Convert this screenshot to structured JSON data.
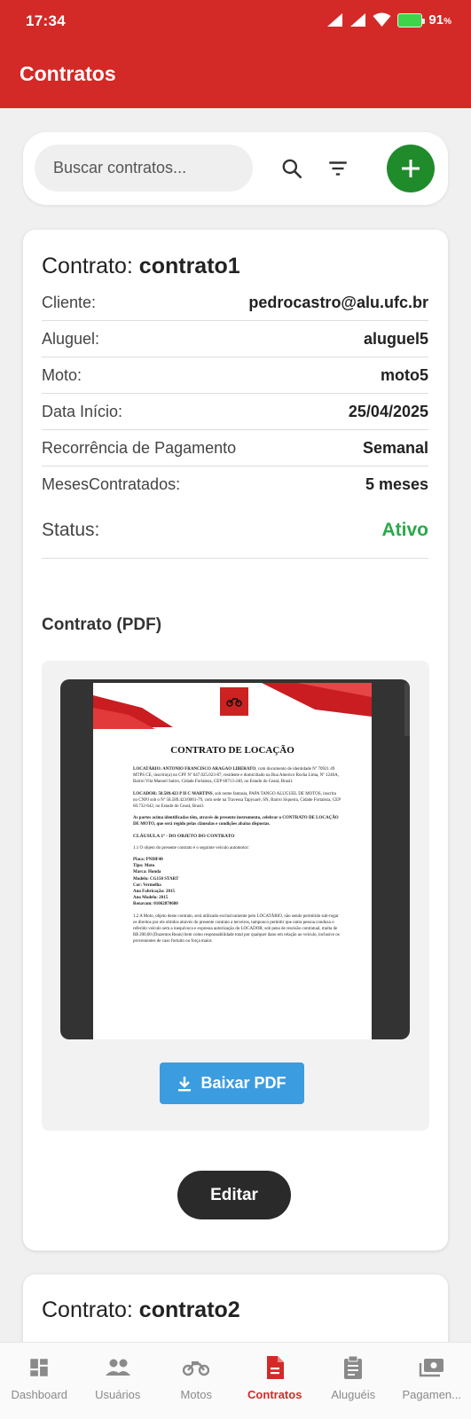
{
  "status_bar": {
    "time": "17:34",
    "battery": "91",
    "battery_unit": "%"
  },
  "app_bar": {
    "title": "Contratos"
  },
  "search": {
    "placeholder": "Buscar contratos..."
  },
  "contracts": [
    {
      "title_prefix": "Contrato:",
      "name": "contrato1",
      "fields": [
        {
          "label": "Cliente:",
          "value": "pedrocastro@alu.ufc.br"
        },
        {
          "label": "Aluguel:",
          "value": "aluguel5"
        },
        {
          "label": "Moto:",
          "value": "moto5"
        },
        {
          "label": "Data Início:",
          "value": "25/04/2025"
        },
        {
          "label": "Recorrência de Pagamento",
          "value": "Semanal"
        },
        {
          "label": "MesesContratados:",
          "value": "5 meses"
        }
      ],
      "status_label": "Status:",
      "status_value": "Ativo",
      "status_color": "#2aa84a",
      "pdf_heading": "Contrato (PDF)",
      "download_label": "Baixar PDF",
      "edit_label": "Editar"
    },
    {
      "title_prefix": "Contrato:",
      "name": "contrato2"
    }
  ],
  "pdf_doc": {
    "title": "CONTRATO DE LOCAÇÃO",
    "p1_bold": "LOCATÁRIO: ANTONIO FRANCISCO ARAGAO LIBERATO",
    "p1": ", com documento de identidade Nº 70921 49 MTPS CE, inscrito(a) no CPF Nº 647.025.023-87, residente e domiciliado na Rua Americo Rocha Lima, Nº 1240A, Bairro Vila Manoel Satiro, Cidade Fortaleza, CEP 60713-240, no Estado do Ceará, Brasil.",
    "p2_bold": "LOCADOR: 58.589.423 P H C MARTINS",
    "p2": ", sob nome fantasia, PAPA TANGO ALUGUEL DE MOTOS, inscrita no CNPJ sob o Nº 58.589.423/0001-79, com sede na Travessa Tapyuaré, SN, Bairro Siqueira, Cidade Fortaleza, CEP 60.732-642, no Estado do Ceará, Brasil.",
    "p3": "As partes acima identificadas têm, através do presente instrumento, celebrar o CONTRATO DE LOCAÇÃO DE MOTO, que será regido pelas cláusulas e condições abaixo dispostas.",
    "clause": "CLÁUSULA 1ª - DO OBJETO DO CONTRATO",
    "c1": "1.1 O objeto do presente contrato é o seguinte veículo automotor:",
    "vehicle": [
      "Placa: PNI8F40",
      "Tipo: Moto",
      "Marca: Honda",
      "Modelo: CG150 START",
      "Cor: Vermelha",
      "Ano Fabricação: 2015",
      "Ano Modelo: 2015",
      "Renavam: 01062870680"
    ],
    "c2": "1.2 A Moto, objeto deste contrato, será utilizado exclusivamente pelo LOCATÁRIO, não sendo permitido sub-rogar os direitos por ele obtidos através do presente contrato a terceiros, tampouco permitir que outra pessoa conduza o referido veículo sem a inequívoca e expressa autorização do LOCADOR, sob pena de rescisão contratual, multa de R$ 200,00 (Duzentos Reais) bem como responsabilidade total por qualquer dano em relação ao veículo, inclusive os provenientes de caso fortuito ou força maior."
  },
  "bottom_nav": [
    {
      "label": "Dashboard",
      "icon": "dashboard-icon",
      "active": false
    },
    {
      "label": "Usuários",
      "icon": "people-icon",
      "active": false
    },
    {
      "label": "Motos",
      "icon": "motorcycle-icon",
      "active": false
    },
    {
      "label": "Contratos",
      "icon": "document-icon",
      "active": true
    },
    {
      "label": "Aluguéis",
      "icon": "clipboard-icon",
      "active": false
    },
    {
      "label": "Pagamen...",
      "icon": "payments-icon",
      "active": false
    }
  ],
  "colors": {
    "brand": "#d32a27",
    "add_button": "#1f8b2b",
    "download_button": "#3c9ce0",
    "edit_button": "#2a2a2a",
    "status_active": "#2aa84a"
  }
}
